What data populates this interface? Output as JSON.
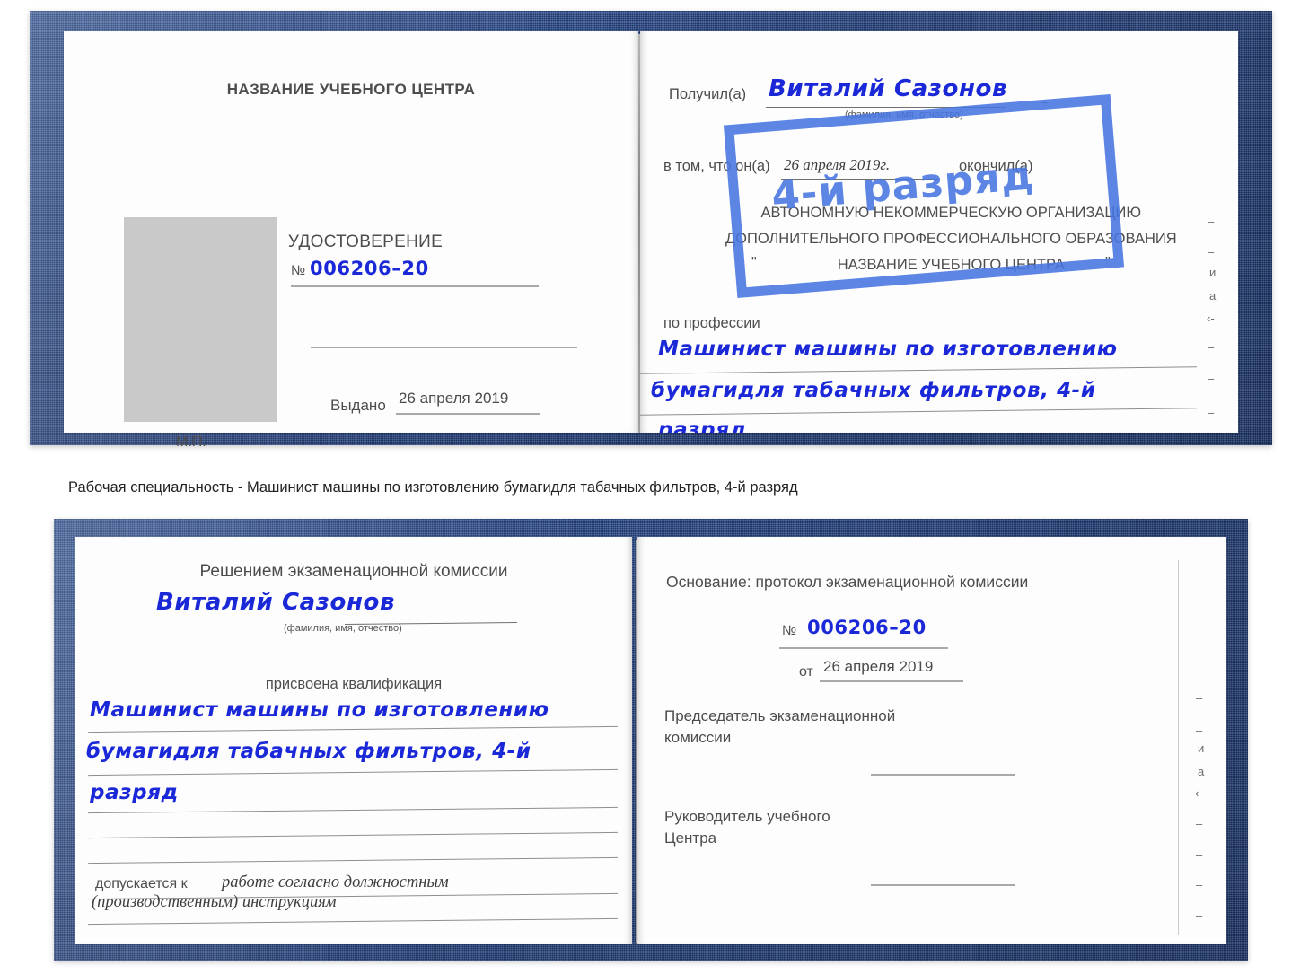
{
  "caption": "Рабочая специальность - Машинист машины по изготовлению бумагидля табачных фильтров, 4-й разряд",
  "colors": {
    "cover_blue": "#25427f",
    "ink_blue": "#1a28d8",
    "stamp_blue": "#4674e0",
    "photo_gray": "#c9c9c9"
  },
  "watermark": {
    "text": "4-й разряд"
  },
  "certificate_front": {
    "left_page": {
      "center_title": "НАЗВАНИЕ УЧЕБНОГО ЦЕНТРА",
      "document_title": "УДОСТОВЕРЕНИЕ",
      "number_symbol": "№",
      "number_value": "006206–20",
      "issued_label": "Выдано",
      "issued_value": "26 апреля 2019",
      "seal_label": "М.П."
    },
    "right_page": {
      "received_label": "Получил(а)",
      "received_value": "Виталий Сазонов",
      "name_hint": "(фамилия, имя, отчество)",
      "that_he_label": "в том, что он(а)",
      "completion_date": "26 апреля 2019г.",
      "finished_label": "окончил(а)",
      "org_line1": "АВТОНОМНУЮ НЕКОММЕРЧЕСКУЮ ОРГАНИЗАЦИЮ",
      "org_line2": "ДОПОЛНИТЕЛЬНОГО ПРОФЕССИОНАЛЬНОГО ОБРАЗОВАНИЯ",
      "org_quote_open": "\"",
      "org_line3": "НАЗВАНИЕ УЧЕБНОГО ЦЕНТРА",
      "org_quote_close": "\"",
      "profession_label": "по профессии",
      "profession_line1": "Машинист машины по изготовлению",
      "profession_line2": "бумагидля табачных фильтров, 4-й",
      "profession_line3": "разряд",
      "edge_fragments": [
        "–",
        "–",
        "–",
        "и",
        "а",
        "‹-",
        "–",
        "–",
        "–"
      ]
    }
  },
  "certificate_inside": {
    "left_page": {
      "decision_title": "Решением экзаменационной комиссии",
      "name_value": "Виталий Сазонов",
      "name_hint": "(фамилия, имя, отчество)",
      "qualification_label": "присвоена квалификация",
      "qualification_line1": "Машинист машины по изготовлению",
      "qualification_line2": "бумагидля табачных фильтров, 4-й",
      "qualification_line3": "разряд",
      "admitted_label": "допускается к",
      "admitted_value_line1": "работе согласно должностным",
      "admitted_value_line2": "(производственным) инструкциям"
    },
    "right_page": {
      "basis_label": "Основание: протокол экзаменационной комиссии",
      "number_symbol": "№",
      "number_value": "006206–20",
      "date_label": "от",
      "date_value": "26 апреля 2019",
      "chairman_line1": "Председатель экзаменационной",
      "chairman_line2": "комиссии",
      "director_line1": "Руководитель учебного",
      "director_line2": "Центра",
      "edge_fragments": [
        "–",
        "–",
        "и",
        "а",
        "‹-",
        "–",
        "–",
        "–",
        "–"
      ]
    }
  }
}
